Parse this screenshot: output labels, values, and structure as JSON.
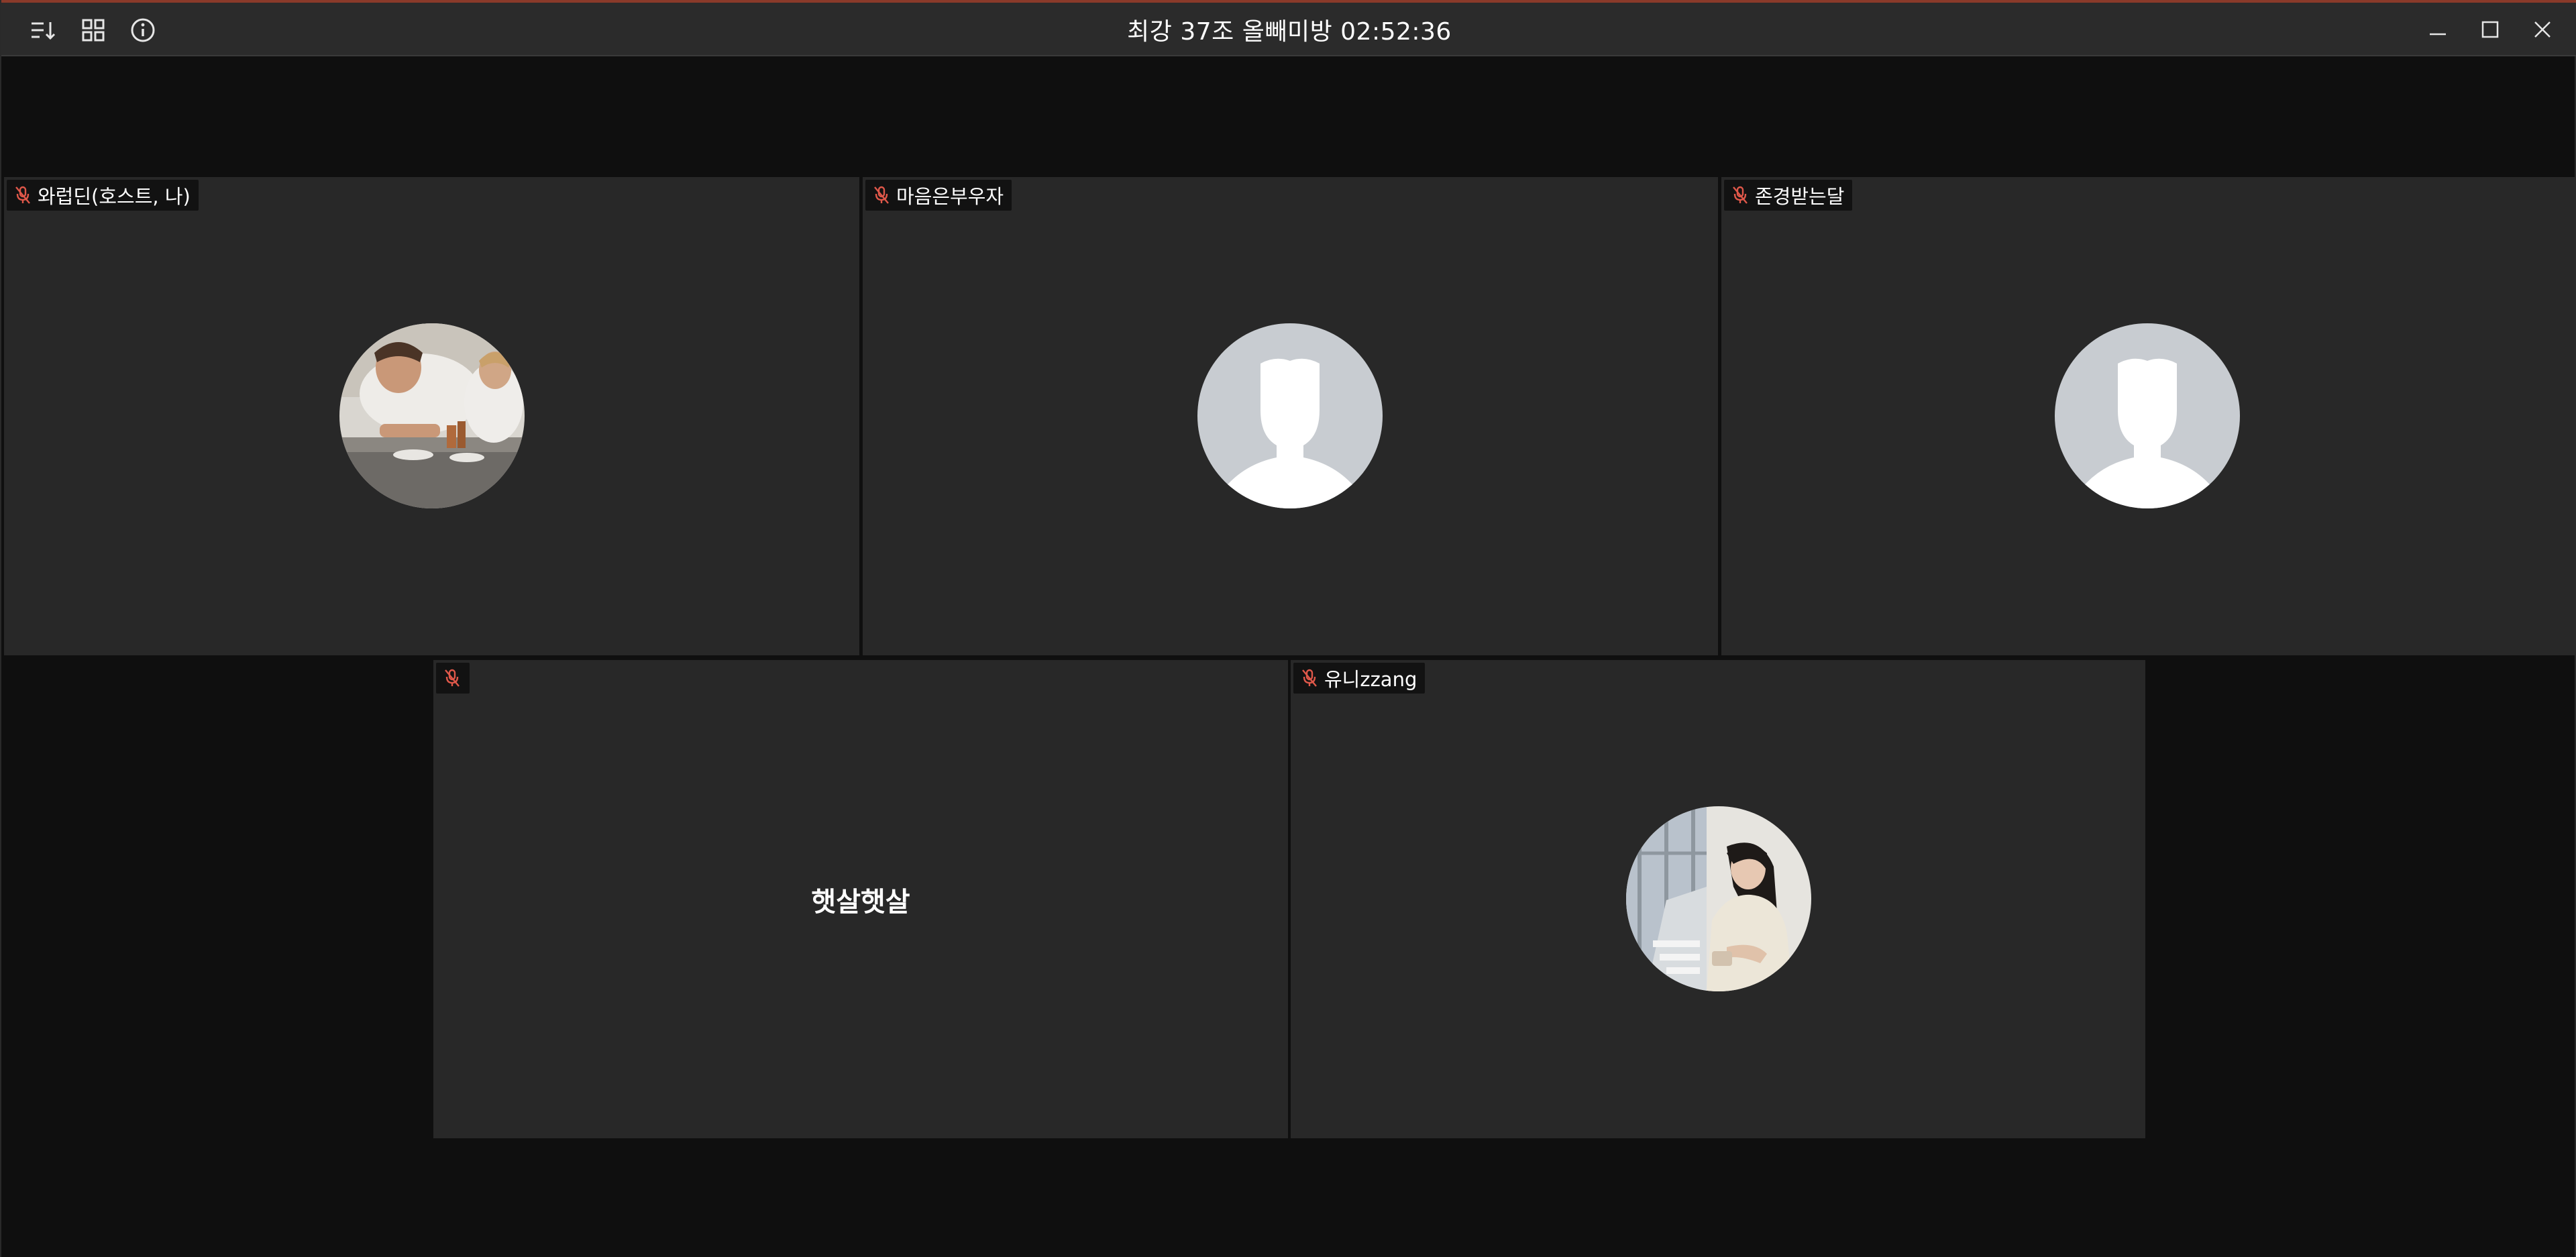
{
  "window": {
    "title": "최강 37조 올빼미방 02:52:36",
    "accent_color": "#8a3a2a"
  },
  "toolbar": {
    "left_icons": [
      "sort-icon",
      "grid-view-icon",
      "info-icon"
    ],
    "right_icons": [
      "minimize-icon",
      "maximize-icon",
      "close-icon"
    ]
  },
  "participants": [
    {
      "name": "와럽딘(호스트, 나)",
      "muted": true,
      "display": "photo-chef"
    },
    {
      "name": "마음은부우자",
      "muted": true,
      "display": "placeholder-avatar"
    },
    {
      "name": "존경받는달",
      "muted": true,
      "display": "placeholder-avatar"
    },
    {
      "name": "",
      "muted": true,
      "display": "text",
      "center_text": "햇살햇살"
    },
    {
      "name": "유니zzang",
      "muted": true,
      "display": "photo-woman"
    }
  ],
  "colors": {
    "tile_bg": "#282828",
    "stage_bg": "#0f0f0f",
    "mic_muted": "#e0584a",
    "placeholder_bg": "#c8ccd1"
  }
}
